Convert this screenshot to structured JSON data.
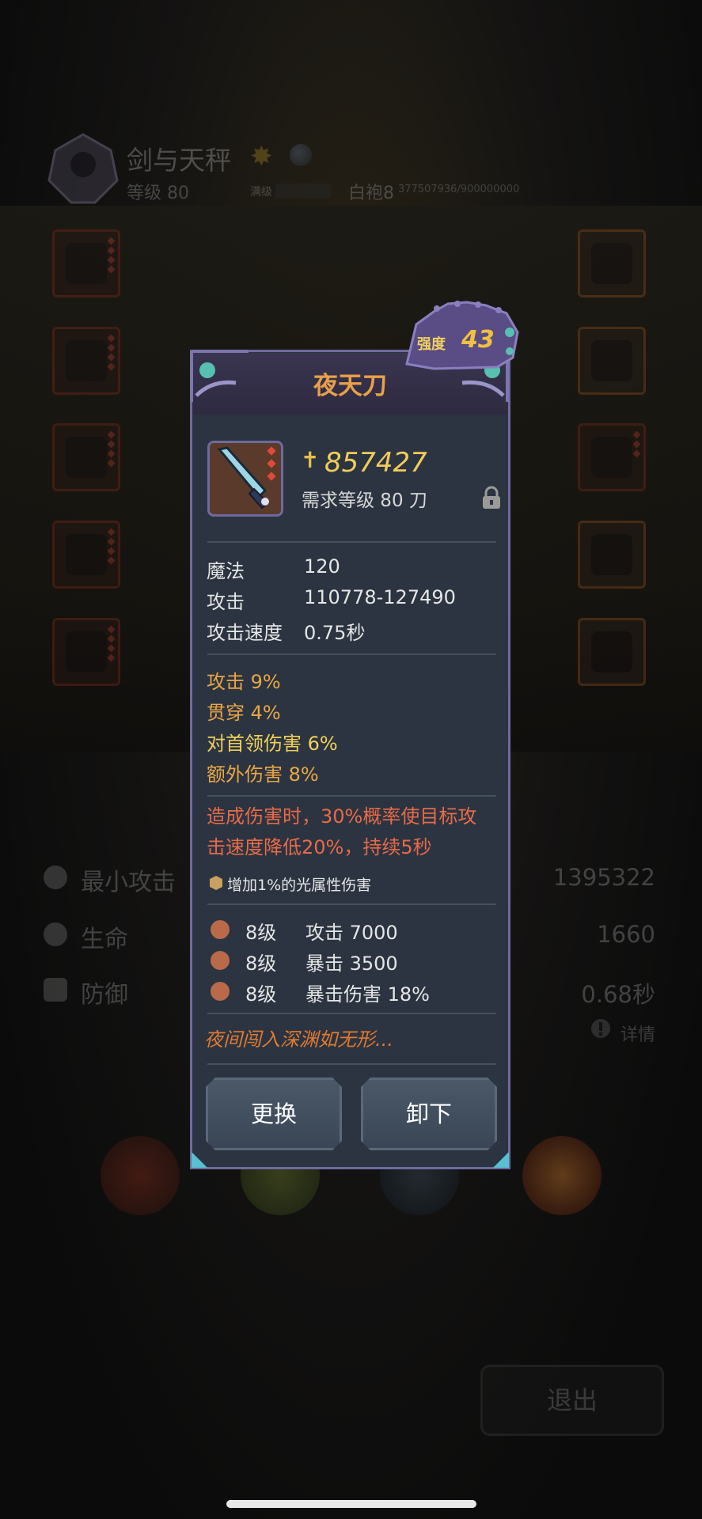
{
  "background": {
    "character": {
      "name": "剑与天秤",
      "level": "等级 80",
      "max_label": "满级",
      "rank": "白袍8",
      "exp": "377507936/900000000"
    },
    "stats": [
      {
        "label": "最小攻击",
        "value": "1395322"
      },
      {
        "label": "生命",
        "value": "1660"
      },
      {
        "label": "防御",
        "value": "0.68秒"
      }
    ],
    "detail_label": "详情",
    "exit_label": "退出"
  },
  "item": {
    "name": "夜天刀",
    "strength_label": "强度",
    "strength_value": "43",
    "power": "857427",
    "requirement": "需求等级 80   刀",
    "base_attrs": [
      {
        "key": "魔法",
        "value": "120"
      },
      {
        "key": "攻击",
        "value": "110778-127490"
      },
      {
        "key": "攻击速度",
        "value": "0.75秒"
      }
    ],
    "bonuses": [
      {
        "text": "攻击   9%"
      },
      {
        "text": "贯穿   4%"
      },
      {
        "text": "对首领伤害   6%"
      },
      {
        "text": "额外伤害   8%"
      }
    ],
    "effect_lines": [
      "造成伤害时，30%概率使目标攻",
      "击速度降低20%，持续5秒"
    ],
    "enchant": "增加1%的光属性伤害",
    "gems": [
      {
        "level": "8级",
        "text": "攻击 7000"
      },
      {
        "level": "8级",
        "text": "暴击 3500"
      },
      {
        "level": "8级",
        "text": "暴击伤害 18%"
      }
    ],
    "flavor": "夜间闯入深渊如无形...",
    "buttons": {
      "replace": "更换",
      "unequip": "卸下"
    }
  },
  "colors": {
    "panel": "#2b3440",
    "frame": "#6e6aa0",
    "title": "#e8a04a",
    "power": "#f0cc5a",
    "bonus": "#eaa646",
    "effect": "#e86a4a"
  }
}
